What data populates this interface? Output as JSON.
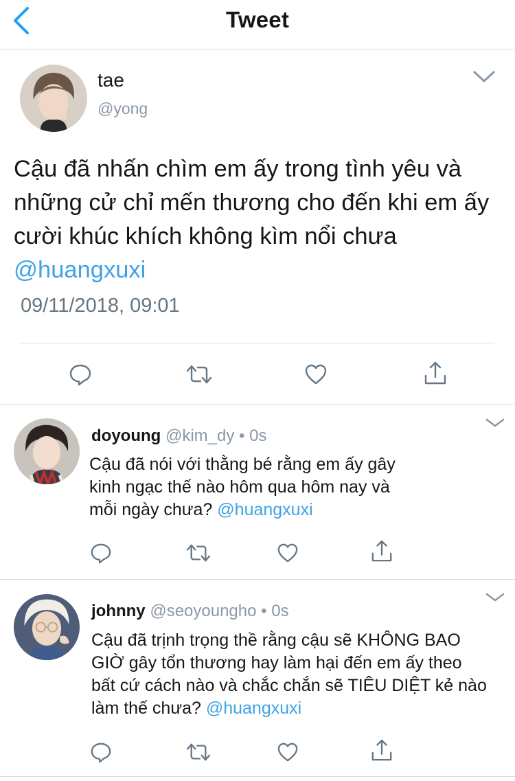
{
  "nav": {
    "title": "Tweet"
  },
  "main_tweet": {
    "name": "tae",
    "handle": "@yong",
    "text": "Cậu đã nhấn chìm em ấy trong tình yêu và những cử chỉ mến thương cho đến khi em ấy cười khúc khích không kìm nổi chưa ",
    "mention": "@huangxuxi",
    "timestamp": "09/11/2018, 09:01"
  },
  "replies": [
    {
      "name": "doyoung",
      "handle": "@kim_dy",
      "dot": "•",
      "time": "0s",
      "text": "Cậu đã nói với thằng bé rằng em ấy gây kinh ngạc thế nào hôm qua hôm nay và mỗi ngày chưa? ",
      "mention": "@huangxuxi"
    },
    {
      "name": "johnny",
      "handle": "@seoyoungho",
      "dot": "•",
      "time": "0s",
      "text": "Cậu đã trịnh trọng thề rằng cậu sẽ KHÔNG BAO GIỜ gây tổn thương hay làm hại đến em ấy theo bất cứ cách nào và chắc chắn sẽ TIÊU DIỆT kẻ nào làm thế chưa? ",
      "mention": "@huangxuxi"
    }
  ],
  "icons": {
    "back": "chevron-left-icon",
    "more": "chevron-down-icon",
    "reply": "speech-bubble-icon",
    "retweet": "retweet-icon",
    "like": "heart-icon",
    "share": "share-icon"
  },
  "colors": {
    "accent": "#1da1f2",
    "mention": "#3ea3e6",
    "icon": "#657786",
    "secondary_text": "#8b98a5",
    "divider": "#d9dde1"
  }
}
